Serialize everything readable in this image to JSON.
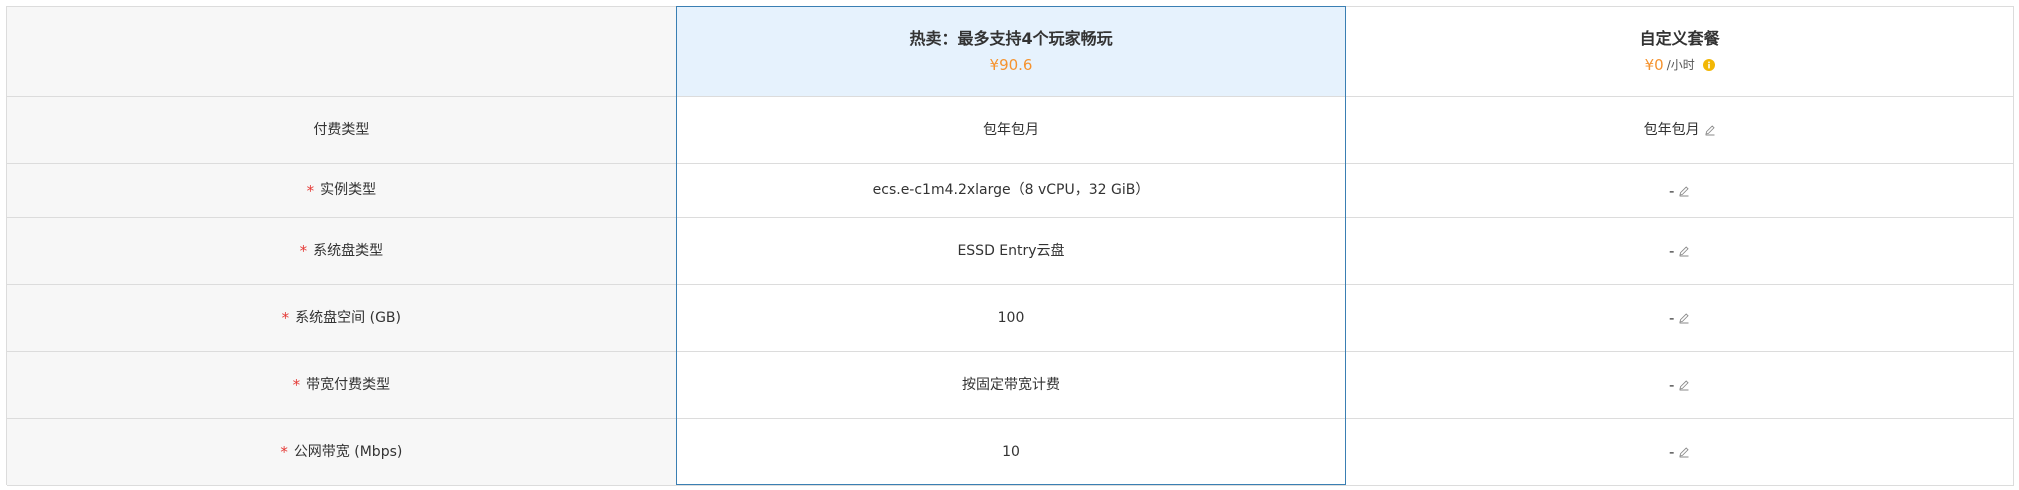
{
  "plans": {
    "hot": {
      "title": "热卖：最多支持4个玩家畅玩",
      "price": "¥90.6"
    },
    "custom": {
      "title": "自定义套餐",
      "price": "¥0",
      "unit": "/小时",
      "info_icon": "info-icon"
    }
  },
  "rows": [
    {
      "label": "付费类型",
      "required": false,
      "hot_value": "包年包月",
      "custom_value": "包年包月"
    },
    {
      "label": "实例类型",
      "required": true,
      "hot_value": "ecs.e-c1m4.2xlarge（8 vCPU，32 GiB）",
      "custom_value": "-"
    },
    {
      "label": "系统盘类型",
      "required": true,
      "hot_value": "ESSD Entry云盘",
      "custom_value": "-"
    },
    {
      "label": "系统盘空间 (GB)",
      "required": true,
      "hot_value": "100",
      "custom_value": "-"
    },
    {
      "label": "带宽付费类型",
      "required": true,
      "hot_value": "按固定带宽计费",
      "custom_value": "-"
    },
    {
      "label": "公网带宽 (Mbps)",
      "required": true,
      "hot_value": "10",
      "custom_value": "-"
    }
  ],
  "required_marker": "*",
  "icons": {
    "edit": "pencil-edit-icon",
    "info": "info-icon"
  },
  "colors": {
    "price": "#f5932f",
    "required": "#e53935",
    "hot_header_bg": "#e6f2fd",
    "hot_outline": "#3a7fb3",
    "label_bg": "#f7f7f7",
    "info_icon": "#f2b705"
  }
}
